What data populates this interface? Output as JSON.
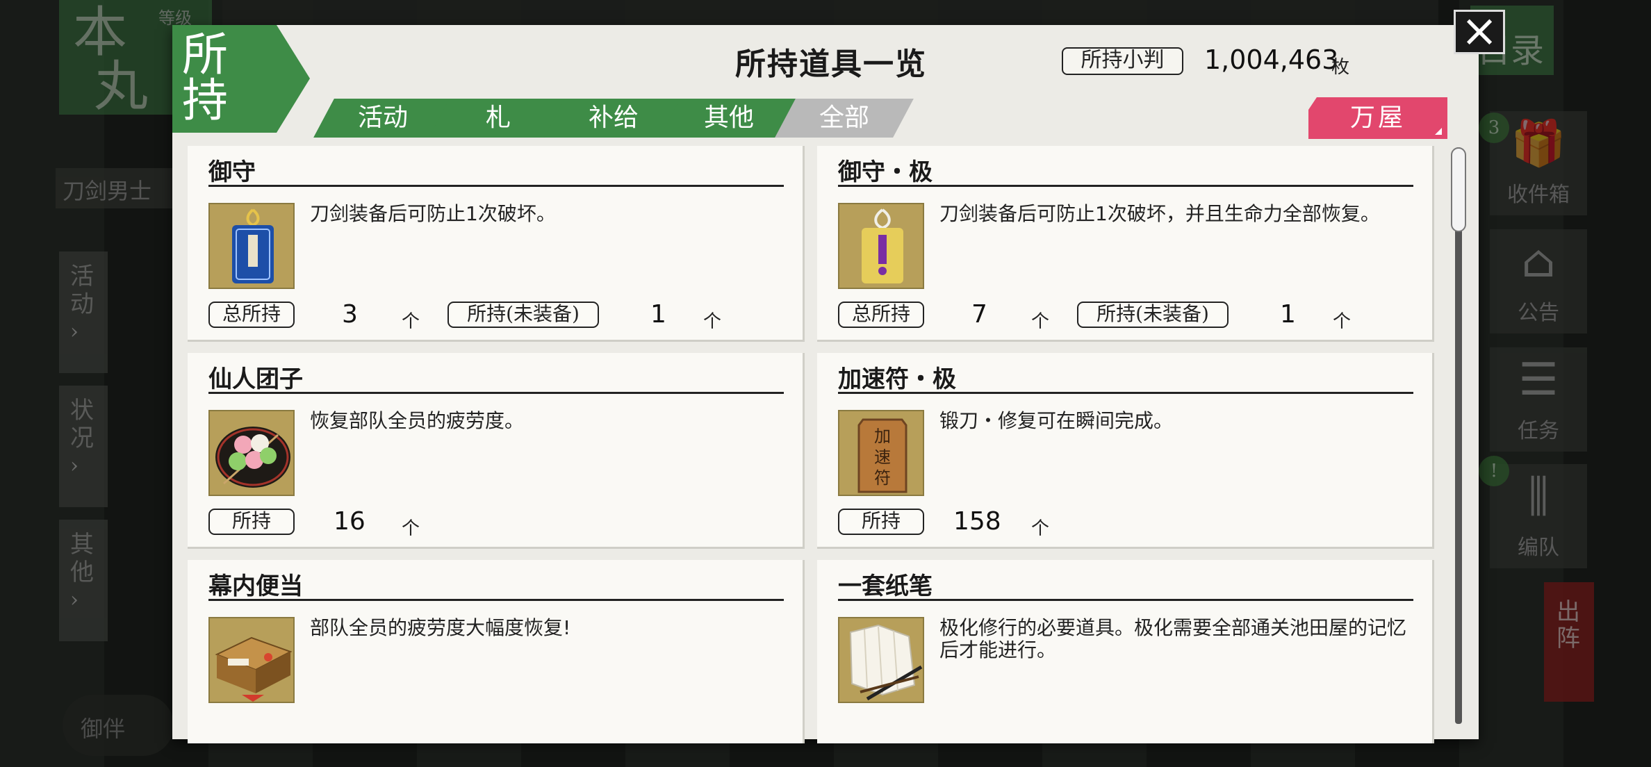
{
  "background": {
    "honmaru_chars": [
      "本",
      "丸"
    ],
    "level_label": "等级",
    "swordsman_label": "刀剑男士",
    "left_tabs": [
      {
        "label": "活动",
        "chev": "›"
      },
      {
        "label": "状况",
        "chev": "›"
      },
      {
        "label": "其他",
        "chev": "›"
      }
    ],
    "menu_label": "目录",
    "right_buttons": [
      {
        "label": "收件箱",
        "icon": "🎁"
      },
      {
        "label": "公告",
        "icon": "⌂"
      },
      {
        "label": "任务",
        "icon": "☰"
      },
      {
        "label": "编队",
        "icon": "⫼"
      }
    ],
    "gift_badge": "3",
    "alert_badge": "!",
    "sortie_label": "出阵",
    "companion_label": "御伴"
  },
  "modal": {
    "corner": [
      "所",
      "持"
    ],
    "title": "所持道具一览",
    "koban_label": "所持小判",
    "koban_value": "1,004,463",
    "koban_unit": "枚",
    "close": "×",
    "tabs": [
      {
        "label": "活动",
        "active": false
      },
      {
        "label": "札",
        "active": false
      },
      {
        "label": "补给",
        "active": false
      },
      {
        "label": "其他",
        "active": false
      },
      {
        "label": "全部",
        "active": true
      }
    ],
    "shop_label": "万屋"
  },
  "items": [
    {
      "name": "御守",
      "desc": "刀剑装备后可防止1次破坏。",
      "icon": "omamori-blue-icon",
      "total_label": "总所持",
      "total": "3",
      "unit1": "个",
      "unequipped_label": "所持(未装备)",
      "unequipped": "1",
      "unit2": "个"
    },
    {
      "name": "御守・极",
      "desc": "刀剑装备后可防止1次破坏，并且生命力全部恢复。",
      "icon": "omamori-gold-icon",
      "total_label": "总所持",
      "total": "7",
      "unit1": "个",
      "unequipped_label": "所持(未装备)",
      "unequipped": "1",
      "unit2": "个"
    },
    {
      "name": "仙人团子",
      "desc": "恢复部队全员的疲劳度。",
      "icon": "dango-icon",
      "held_label": "所持",
      "held": "16",
      "unit1": "个"
    },
    {
      "name": "加速符・极",
      "desc": "锻刀・修复可在瞬间完成。",
      "icon": "speed-charm-icon",
      "icon_text": "加速符",
      "held_label": "所持",
      "held": "158",
      "unit1": "个"
    },
    {
      "name": "幕内便当",
      "desc": "部队全员的疲劳度大幅度恢复!",
      "icon": "bento-icon"
    },
    {
      "name": "一套纸笔",
      "desc": "极化修行的必要道具。极化需要全部通关池田屋的记忆后才能进行。",
      "icon": "paper-brush-icon"
    }
  ],
  "colors": {
    "tab_green": "#3e8c47",
    "tab_active": "#b9b9b9",
    "shop_pink": "#e2476d",
    "modal_bg": "#ecebe6",
    "card_bg": "#faf9f5"
  }
}
